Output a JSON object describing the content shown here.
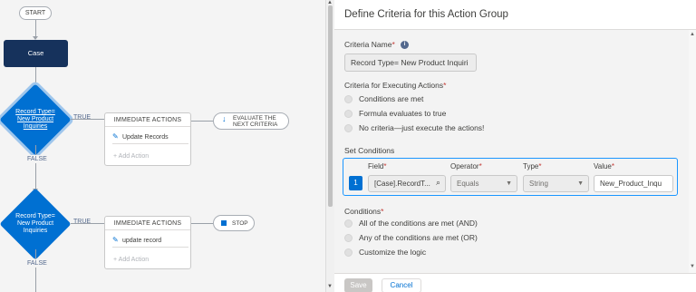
{
  "canvas": {
    "start_label": "START",
    "case_label": "Case",
    "criteria": [
      {
        "label_lines": [
          "Record Type=",
          "New Product",
          "Inquiries"
        ],
        "true_label": "TRUE",
        "false_label": "FALSE",
        "actions_header": "IMMEDIATE ACTIONS",
        "action_item": "Update Records",
        "add_action": "+ Add Action",
        "next_lines": [
          "EVALUATE THE",
          "NEXT CRITERIA"
        ]
      },
      {
        "label_lines": [
          "Record Type=",
          "New Product",
          "Inquiries"
        ],
        "true_label": "TRUE",
        "false_label": "FALSE",
        "actions_header": "IMMEDIATE ACTIONS",
        "action_item": "update record",
        "add_action": "+ Add Action",
        "stop_label": "STOP"
      }
    ]
  },
  "panel": {
    "title": "Define Criteria for this Action Group",
    "criteria_name_label": "Criteria Name",
    "criteria_name_value": "Record Type= New Product Inquiri",
    "executing_label": "Criteria for Executing Actions",
    "executing_options": [
      "Conditions are met",
      "Formula evaluates to true",
      "No criteria—just execute the actions!"
    ],
    "set_conditions_label": "Set Conditions",
    "condition_headers": {
      "field": "Field",
      "operator": "Operator",
      "type": "Type",
      "value": "Value"
    },
    "condition_row": {
      "number": "1",
      "field": "[Case].RecordT...",
      "operator": "Equals",
      "type": "String",
      "value": "New_Product_Inqu"
    },
    "conditions_label": "Conditions",
    "conditions_options": [
      "All of the conditions are met (AND)",
      "Any of the conditions are met (OR)",
      "Customize the logic"
    ],
    "save_label": "Save",
    "cancel_label": "Cancel"
  }
}
